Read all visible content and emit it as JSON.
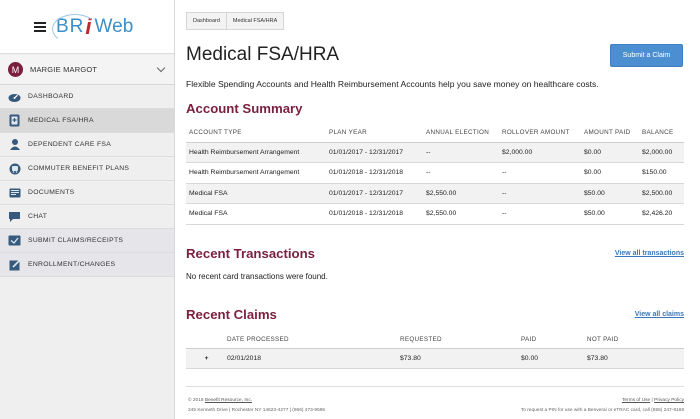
{
  "logo": {
    "bri": "BR",
    "i": "i",
    "web": "Web"
  },
  "user": {
    "initial": "M",
    "name": "MARGIE MARGOT"
  },
  "nav": [
    {
      "label": "DASHBOARD",
      "icon": "dashboard-icon"
    },
    {
      "label": "MEDICAL FSA/HRA",
      "icon": "medical-card-icon"
    },
    {
      "label": "DEPENDENT CARE FSA",
      "icon": "dependent-icon"
    },
    {
      "label": "COMMUTER BENEFIT PLANS",
      "icon": "commuter-icon"
    },
    {
      "label": "DOCUMENTS",
      "icon": "documents-icon"
    },
    {
      "label": "CHAT",
      "icon": "chat-icon"
    },
    {
      "label": "SUBMIT CLAIMS/RECEIPTS",
      "icon": "receipt-icon"
    },
    {
      "label": "ENROLLMENT/CHANGES",
      "icon": "enrollment-icon"
    }
  ],
  "breadcrumb": [
    "Dashboard",
    "Medical FSA/HRA"
  ],
  "page": {
    "title": "Medical FSA/HRA",
    "submit_label": "Submit a Claim",
    "intro": "Flexible Spending Accounts and Health Reimbursement Accounts help you save money on healthcare costs."
  },
  "account_summary": {
    "title": "Account Summary",
    "headers": [
      "ACCOUNT TYPE",
      "PLAN YEAR",
      "ANNUAL ELECTION",
      "ROLLOVER AMOUNT",
      "AMOUNT PAID",
      "BALANCE"
    ],
    "rows": [
      [
        "Health Reimbursement Arrangement",
        "01/01/2017 - 12/31/2017",
        "--",
        "$2,000.00",
        "$0.00",
        "$2,000.00"
      ],
      [
        "Health Reimbursement Arrangement",
        "01/01/2018 - 12/31/2018",
        "--",
        "--",
        "$0.00",
        "$150.00"
      ],
      [
        "Medical FSA",
        "01/01/2017 - 12/31/2017",
        "$2,550.00",
        "--",
        "$50.00",
        "$2,500.00"
      ],
      [
        "Medical FSA",
        "01/01/2018 - 12/31/2018",
        "$2,550.00",
        "--",
        "$50.00",
        "$2,426.20"
      ]
    ]
  },
  "recent_transactions": {
    "title": "Recent Transactions",
    "link": "View all transactions",
    "empty": "No recent card transactions were found."
  },
  "recent_claims": {
    "title": "Recent Claims",
    "link": "View all claims",
    "headers": [
      "",
      "DATE PROCESSED",
      "REQUESTED",
      "PAID",
      "NOT PAID"
    ],
    "rows": [
      {
        "expand": "+",
        "date": "02/01/2018",
        "requested": "$73.80",
        "paid": "$0.00",
        "not_paid": "$73.80"
      }
    ]
  },
  "footer": {
    "copyright_prefix": "© 2018 ",
    "company_link": "Benefit Resource, Inc.",
    "address": "245 Kenneth Drive | Rochester NY 14623-4277 | (866) 473-9595",
    "terms": "Terms of Use",
    "privacy": "Privacy Policy",
    "sep": " | ",
    "pin_note": "To request a PIN for use with a Benveral or eTRAC card, call (855) 247-9169"
  }
}
